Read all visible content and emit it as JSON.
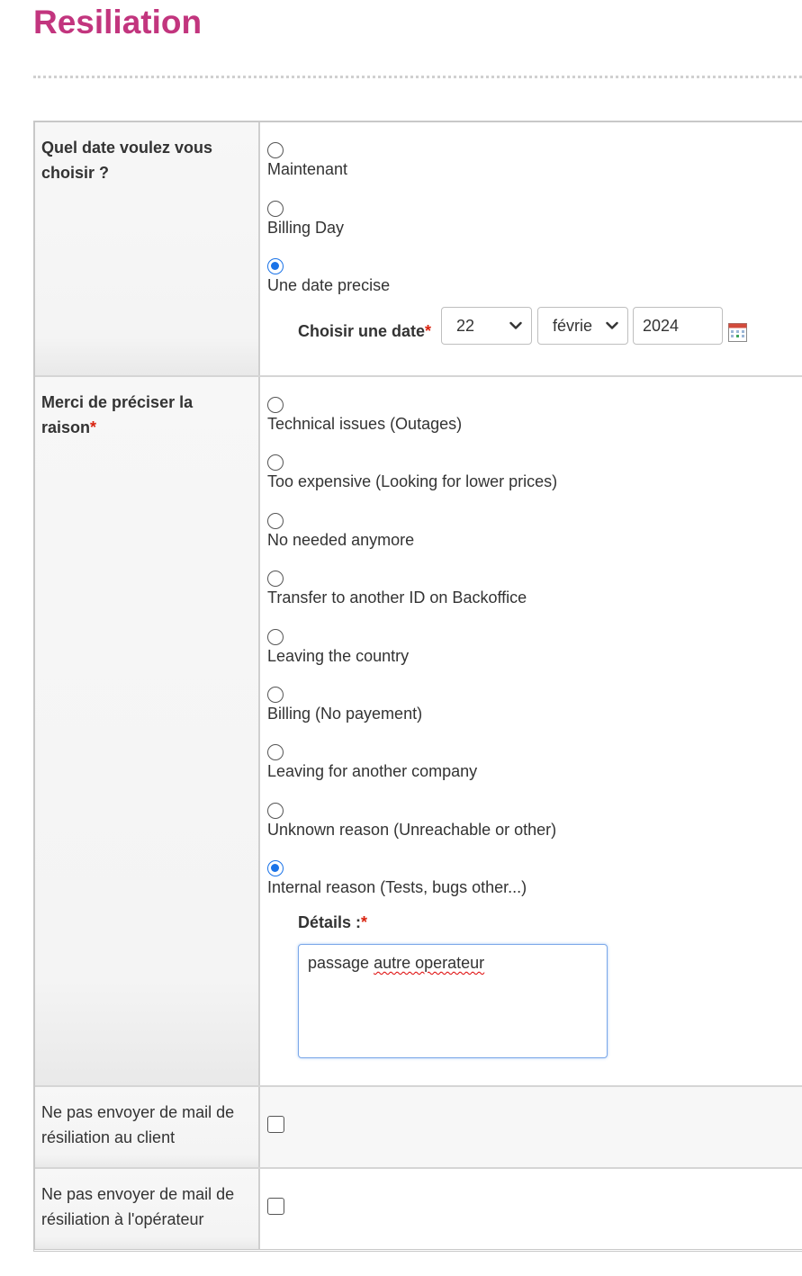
{
  "page": {
    "title": "Resiliation"
  },
  "date_section": {
    "label": "Quel date voulez vous choisir ?",
    "options": [
      {
        "label": "Maintenant",
        "checked": false
      },
      {
        "label": "Billing Day",
        "checked": false
      },
      {
        "label": "Une date precise",
        "checked": true
      }
    ],
    "date_picker": {
      "label": "Choisir une date",
      "required_mark": "*",
      "day": "22",
      "month": "févrie",
      "year": "2024"
    }
  },
  "reason_section": {
    "label": "Merci de préciser la raison",
    "required_mark": "*",
    "options": [
      {
        "label": "Technical issues (Outages)",
        "checked": false
      },
      {
        "label": "Too expensive (Looking for lower prices)",
        "checked": false
      },
      {
        "label": "No needed anymore",
        "checked": false
      },
      {
        "label": "Transfer to another ID on Backoffice",
        "checked": false
      },
      {
        "label": "Leaving the country",
        "checked": false
      },
      {
        "label": "Billing (No payement)",
        "checked": false
      },
      {
        "label": "Leaving for another company",
        "checked": false
      },
      {
        "label": "Unknown reason (Unreachable or other)",
        "checked": false
      },
      {
        "label": "Internal reason (Tests, bugs other...)",
        "checked": true
      }
    ],
    "details": {
      "label": "Détails :",
      "required_mark": "*",
      "value_part1": "passage ",
      "value_part2": "autre operateur"
    }
  },
  "options_section": {
    "no_mail_client": {
      "label": "Ne pas envoyer de mail de résiliation au client",
      "checked": false
    },
    "no_mail_operator": {
      "label": "Ne pas envoyer de mail de résiliation à l'opérateur",
      "checked": false
    }
  },
  "colors": {
    "title": "#c2357e",
    "accent": "#1a73e8",
    "required": "#d9230f"
  }
}
